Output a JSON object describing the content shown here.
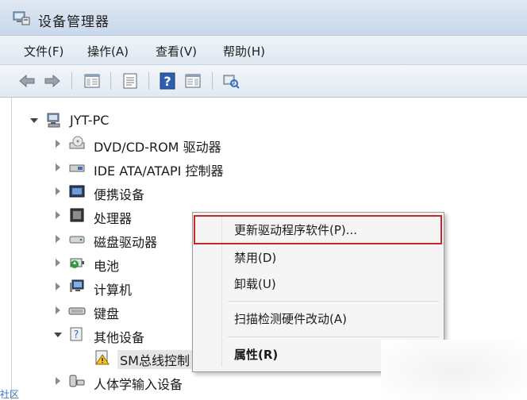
{
  "window": {
    "title": "设备管理器"
  },
  "menubar": {
    "items": [
      {
        "label": "文件(F)"
      },
      {
        "label": "操作(A)"
      },
      {
        "label": "查看(V)"
      },
      {
        "label": "帮助(H)"
      }
    ]
  },
  "toolbar": {
    "buttons": [
      {
        "icon": "back-arrow-icon"
      },
      {
        "icon": "forward-arrow-icon"
      },
      {
        "icon": "show-hide-console-tree-icon"
      },
      {
        "icon": "properties-icon"
      },
      {
        "icon": "help-icon"
      },
      {
        "icon": "action-pane-icon"
      },
      {
        "icon": "scan-hardware-icon"
      }
    ]
  },
  "tree": {
    "root": {
      "label": "JYT-PC",
      "expanded": true
    },
    "items": [
      {
        "label": "DVD/CD-ROM 驱动器",
        "icon": "dvd-drive-icon",
        "expanded": false
      },
      {
        "label": "IDE ATA/ATAPI 控制器",
        "icon": "ide-controller-icon",
        "expanded": false
      },
      {
        "label": "便携设备",
        "icon": "portable-device-icon",
        "expanded": false
      },
      {
        "label": "处理器",
        "icon": "processor-icon",
        "expanded": false
      },
      {
        "label": "磁盘驱动器",
        "icon": "disk-drive-icon",
        "expanded": false
      },
      {
        "label": "电池",
        "icon": "battery-icon",
        "expanded": false
      },
      {
        "label": "计算机",
        "icon": "computer-icon",
        "expanded": false
      },
      {
        "label": "键盘",
        "icon": "keyboard-icon",
        "expanded": false
      },
      {
        "label": "其他设备",
        "icon": "unknown-device-icon",
        "expanded": true
      },
      {
        "label": "SM总线控制",
        "icon": "warning-device-icon",
        "child": true
      },
      {
        "label": "人体学输入设备",
        "icon": "hid-icon",
        "expanded": false
      }
    ]
  },
  "context_menu": {
    "items": [
      {
        "label": "更新驱动程序软件(P)...",
        "highlighted": true
      },
      {
        "label": "禁用(D)"
      },
      {
        "label": "卸载(U)"
      },
      {
        "label": "扫描检测硬件改动(A)"
      },
      {
        "label": "属性(R)",
        "bold": true
      }
    ],
    "highlight_color": "#c8282c"
  },
  "watermark": {
    "text": "社区"
  }
}
